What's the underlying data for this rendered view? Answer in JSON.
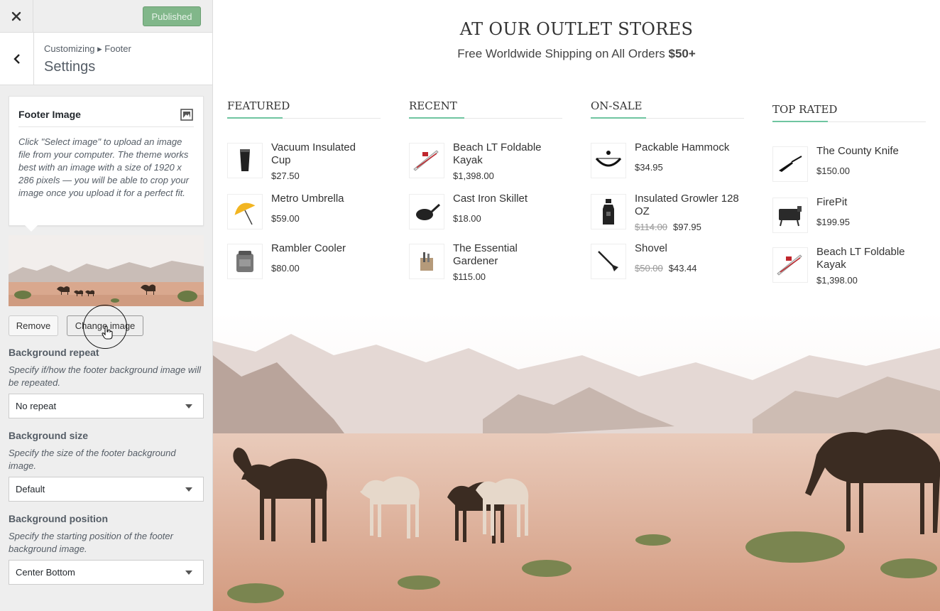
{
  "topbar": {
    "close_icon": "close-icon",
    "publish_label": "Published"
  },
  "section": {
    "breadcrumb": "Customizing ▸ Footer",
    "title": "Settings"
  },
  "footer_image": {
    "title": "Footer Image",
    "icon": "image-icon",
    "description": "Click \"Select image\" to upload an image file from your computer. The theme works best with an image with a size of 1920 x 286 pixels — you will be able to crop your image once you upload it for a perfect fit.",
    "remove_label": "Remove",
    "change_label": "Change image"
  },
  "controls": [
    {
      "label": "Background repeat",
      "description": "Specify if/how the footer background image will be repeated.",
      "value": "No repeat"
    },
    {
      "label": "Background size",
      "description": "Specify the size of the footer background image.",
      "value": "Default"
    },
    {
      "label": "Background position",
      "description": "Specify the starting position of the footer background image.",
      "value": "Center Bottom"
    }
  ],
  "preview": {
    "title": "AT OUR OUTLET STORES",
    "subtitle_text": "Free Worldwide Shipping on All Orders ",
    "subtitle_bold": "$50+",
    "accent_color": "#6fc5a0",
    "columns": [
      {
        "heading": "FEATURED",
        "products": [
          {
            "name": "Vacuum Insulated Cup",
            "price": "$27.50",
            "old_price": ""
          },
          {
            "name": "Metro Umbrella",
            "price": "$59.00",
            "old_price": ""
          },
          {
            "name": "Rambler Cooler",
            "price": "$80.00",
            "old_price": ""
          }
        ]
      },
      {
        "heading": "RECENT",
        "products": [
          {
            "name": "Beach LT Foldable Kayak",
            "price": "$1,398.00",
            "old_price": ""
          },
          {
            "name": "Cast Iron Skillet",
            "price": "$18.00",
            "old_price": ""
          },
          {
            "name": "The Essential Gardener",
            "price": "$115.00",
            "old_price": ""
          }
        ]
      },
      {
        "heading": "ON-SALE",
        "products": [
          {
            "name": "Packable Hammock",
            "price": "$34.95",
            "old_price": ""
          },
          {
            "name": "Insulated Growler 128 OZ",
            "price": "$97.95",
            "old_price": "$114.00"
          },
          {
            "name": "Shovel",
            "price": "$43.44",
            "old_price": "$50.00"
          }
        ]
      },
      {
        "heading": "TOP RATED",
        "products": [
          {
            "name": "The County Knife",
            "price": "$150.00",
            "old_price": ""
          },
          {
            "name": "FirePit",
            "price": "$199.95",
            "old_price": ""
          },
          {
            "name": "Beach LT Foldable Kayak",
            "price": "$1,398.00",
            "old_price": ""
          }
        ]
      }
    ]
  }
}
